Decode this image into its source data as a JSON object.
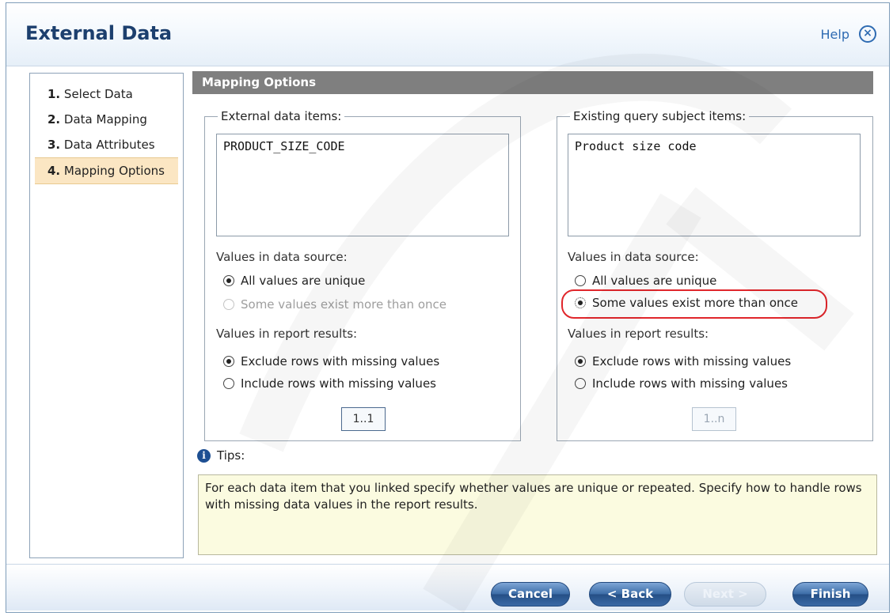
{
  "dialog": {
    "title": "External Data",
    "help_label": "Help",
    "close_glyph": "×"
  },
  "steps": [
    {
      "num": "1.",
      "label": "Select Data",
      "active": false
    },
    {
      "num": "2.",
      "label": "Data Mapping",
      "active": false
    },
    {
      "num": "3.",
      "label": "Data Attributes",
      "active": false
    },
    {
      "num": "4.",
      "label": "Mapping Options",
      "active": true
    }
  ],
  "section_header": "Mapping Options",
  "left_panel": {
    "legend": "External data items:",
    "list_items": [
      "PRODUCT_SIZE_CODE"
    ],
    "values_source_label": "Values in data source:",
    "source_options": [
      {
        "label": "All values are unique",
        "checked": true,
        "disabled": false
      },
      {
        "label": "Some values exist more than once",
        "checked": false,
        "disabled": true
      }
    ],
    "report_label": "Values in report results:",
    "report_options": [
      {
        "label": "Exclude rows with missing values",
        "checked": true
      },
      {
        "label": "Include rows with missing values",
        "checked": false
      }
    ],
    "cardinality": "1..1"
  },
  "right_panel": {
    "legend": "Existing query subject items:",
    "list_items": [
      "Product size code"
    ],
    "values_source_label": "Values in data source:",
    "source_options": [
      {
        "label": "All values are unique",
        "checked": false,
        "disabled": false
      },
      {
        "label": "Some values exist more than once",
        "checked": true,
        "disabled": false
      }
    ],
    "report_label": "Values in report results:",
    "report_options": [
      {
        "label": "Exclude rows with missing values",
        "checked": true
      },
      {
        "label": "Include rows with missing values",
        "checked": false
      }
    ],
    "cardinality": "1..n"
  },
  "tips": {
    "label": "Tips:",
    "icon": "info-icon",
    "text": "For each data item that you linked specify whether values are unique or repeated. Specify how to handle rows with missing data values in the report results."
  },
  "footer": {
    "cancel": "Cancel",
    "back": "< Back",
    "next": "Next >",
    "finish": "Finish"
  },
  "colors": {
    "title": "#1c3f6e",
    "header_bar": "#7f7f7f",
    "active_step": "#fbe6c3",
    "highlight": "#e0262b",
    "tip_bg": "#fbfbe0"
  }
}
